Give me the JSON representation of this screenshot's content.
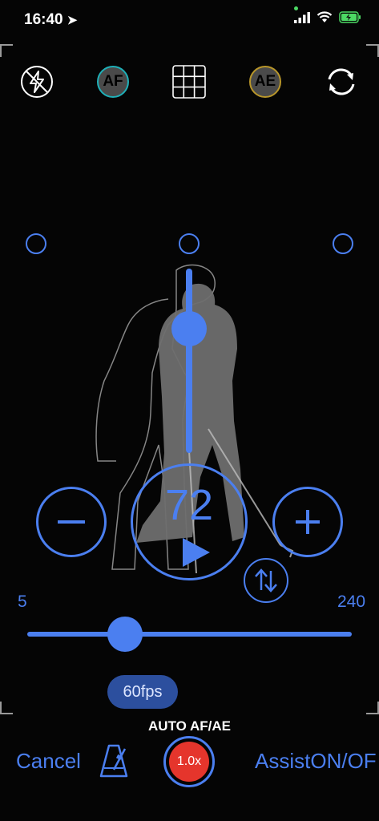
{
  "status_bar": {
    "time": "16:40"
  },
  "toolbar": {
    "af_label": "AF",
    "ae_label": "AE"
  },
  "speed": {
    "value": "72",
    "min_label": "5",
    "max_label": "240",
    "slider_fraction": 0.3
  },
  "fps": {
    "label": "60fps"
  },
  "mode": {
    "label": "AUTO AF/AE"
  },
  "bottom_bar": {
    "cancel_label": "Cancel",
    "zoom_label": "1.0x",
    "assist_label": "AssistON/OF"
  },
  "colors": {
    "accent": "#4b7ff0",
    "record": "#e5352c",
    "battery": "#4cd964"
  }
}
